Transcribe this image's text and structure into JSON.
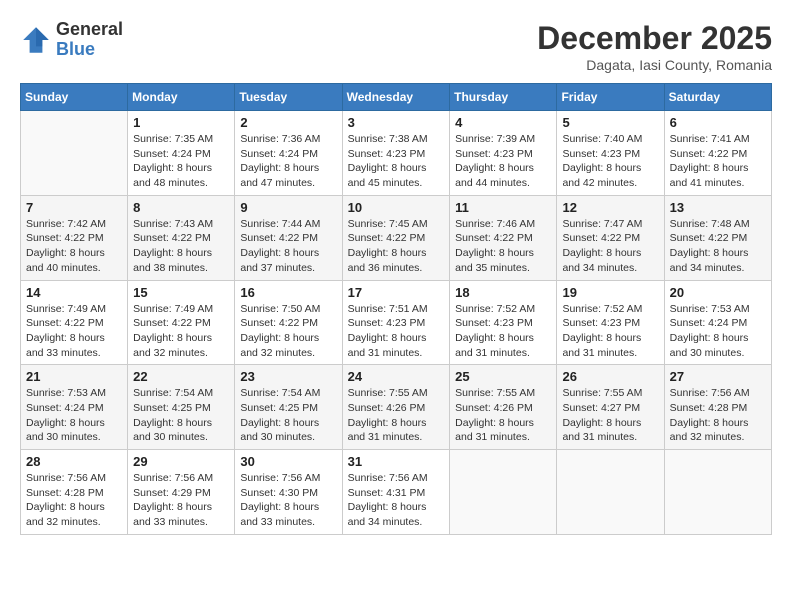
{
  "header": {
    "logo_line1": "General",
    "logo_line2": "Blue",
    "month": "December 2025",
    "location": "Dagata, Iasi County, Romania"
  },
  "weekdays": [
    "Sunday",
    "Monday",
    "Tuesday",
    "Wednesday",
    "Thursday",
    "Friday",
    "Saturday"
  ],
  "weeks": [
    [
      {
        "day": "",
        "sunrise": "",
        "sunset": "",
        "daylight": ""
      },
      {
        "day": "1",
        "sunrise": "Sunrise: 7:35 AM",
        "sunset": "Sunset: 4:24 PM",
        "daylight": "Daylight: 8 hours and 48 minutes."
      },
      {
        "day": "2",
        "sunrise": "Sunrise: 7:36 AM",
        "sunset": "Sunset: 4:24 PM",
        "daylight": "Daylight: 8 hours and 47 minutes."
      },
      {
        "day": "3",
        "sunrise": "Sunrise: 7:38 AM",
        "sunset": "Sunset: 4:23 PM",
        "daylight": "Daylight: 8 hours and 45 minutes."
      },
      {
        "day": "4",
        "sunrise": "Sunrise: 7:39 AM",
        "sunset": "Sunset: 4:23 PM",
        "daylight": "Daylight: 8 hours and 44 minutes."
      },
      {
        "day": "5",
        "sunrise": "Sunrise: 7:40 AM",
        "sunset": "Sunset: 4:23 PM",
        "daylight": "Daylight: 8 hours and 42 minutes."
      },
      {
        "day": "6",
        "sunrise": "Sunrise: 7:41 AM",
        "sunset": "Sunset: 4:22 PM",
        "daylight": "Daylight: 8 hours and 41 minutes."
      }
    ],
    [
      {
        "day": "7",
        "sunrise": "Sunrise: 7:42 AM",
        "sunset": "Sunset: 4:22 PM",
        "daylight": "Daylight: 8 hours and 40 minutes."
      },
      {
        "day": "8",
        "sunrise": "Sunrise: 7:43 AM",
        "sunset": "Sunset: 4:22 PM",
        "daylight": "Daylight: 8 hours and 38 minutes."
      },
      {
        "day": "9",
        "sunrise": "Sunrise: 7:44 AM",
        "sunset": "Sunset: 4:22 PM",
        "daylight": "Daylight: 8 hours and 37 minutes."
      },
      {
        "day": "10",
        "sunrise": "Sunrise: 7:45 AM",
        "sunset": "Sunset: 4:22 PM",
        "daylight": "Daylight: 8 hours and 36 minutes."
      },
      {
        "day": "11",
        "sunrise": "Sunrise: 7:46 AM",
        "sunset": "Sunset: 4:22 PM",
        "daylight": "Daylight: 8 hours and 35 minutes."
      },
      {
        "day": "12",
        "sunrise": "Sunrise: 7:47 AM",
        "sunset": "Sunset: 4:22 PM",
        "daylight": "Daylight: 8 hours and 34 minutes."
      },
      {
        "day": "13",
        "sunrise": "Sunrise: 7:48 AM",
        "sunset": "Sunset: 4:22 PM",
        "daylight": "Daylight: 8 hours and 34 minutes."
      }
    ],
    [
      {
        "day": "14",
        "sunrise": "Sunrise: 7:49 AM",
        "sunset": "Sunset: 4:22 PM",
        "daylight": "Daylight: 8 hours and 33 minutes."
      },
      {
        "day": "15",
        "sunrise": "Sunrise: 7:49 AM",
        "sunset": "Sunset: 4:22 PM",
        "daylight": "Daylight: 8 hours and 32 minutes."
      },
      {
        "day": "16",
        "sunrise": "Sunrise: 7:50 AM",
        "sunset": "Sunset: 4:22 PM",
        "daylight": "Daylight: 8 hours and 32 minutes."
      },
      {
        "day": "17",
        "sunrise": "Sunrise: 7:51 AM",
        "sunset": "Sunset: 4:23 PM",
        "daylight": "Daylight: 8 hours and 31 minutes."
      },
      {
        "day": "18",
        "sunrise": "Sunrise: 7:52 AM",
        "sunset": "Sunset: 4:23 PM",
        "daylight": "Daylight: 8 hours and 31 minutes."
      },
      {
        "day": "19",
        "sunrise": "Sunrise: 7:52 AM",
        "sunset": "Sunset: 4:23 PM",
        "daylight": "Daylight: 8 hours and 31 minutes."
      },
      {
        "day": "20",
        "sunrise": "Sunrise: 7:53 AM",
        "sunset": "Sunset: 4:24 PM",
        "daylight": "Daylight: 8 hours and 30 minutes."
      }
    ],
    [
      {
        "day": "21",
        "sunrise": "Sunrise: 7:53 AM",
        "sunset": "Sunset: 4:24 PM",
        "daylight": "Daylight: 8 hours and 30 minutes."
      },
      {
        "day": "22",
        "sunrise": "Sunrise: 7:54 AM",
        "sunset": "Sunset: 4:25 PM",
        "daylight": "Daylight: 8 hours and 30 minutes."
      },
      {
        "day": "23",
        "sunrise": "Sunrise: 7:54 AM",
        "sunset": "Sunset: 4:25 PM",
        "daylight": "Daylight: 8 hours and 30 minutes."
      },
      {
        "day": "24",
        "sunrise": "Sunrise: 7:55 AM",
        "sunset": "Sunset: 4:26 PM",
        "daylight": "Daylight: 8 hours and 31 minutes."
      },
      {
        "day": "25",
        "sunrise": "Sunrise: 7:55 AM",
        "sunset": "Sunset: 4:26 PM",
        "daylight": "Daylight: 8 hours and 31 minutes."
      },
      {
        "day": "26",
        "sunrise": "Sunrise: 7:55 AM",
        "sunset": "Sunset: 4:27 PM",
        "daylight": "Daylight: 8 hours and 31 minutes."
      },
      {
        "day": "27",
        "sunrise": "Sunrise: 7:56 AM",
        "sunset": "Sunset: 4:28 PM",
        "daylight": "Daylight: 8 hours and 32 minutes."
      }
    ],
    [
      {
        "day": "28",
        "sunrise": "Sunrise: 7:56 AM",
        "sunset": "Sunset: 4:28 PM",
        "daylight": "Daylight: 8 hours and 32 minutes."
      },
      {
        "day": "29",
        "sunrise": "Sunrise: 7:56 AM",
        "sunset": "Sunset: 4:29 PM",
        "daylight": "Daylight: 8 hours and 33 minutes."
      },
      {
        "day": "30",
        "sunrise": "Sunrise: 7:56 AM",
        "sunset": "Sunset: 4:30 PM",
        "daylight": "Daylight: 8 hours and 33 minutes."
      },
      {
        "day": "31",
        "sunrise": "Sunrise: 7:56 AM",
        "sunset": "Sunset: 4:31 PM",
        "daylight": "Daylight: 8 hours and 34 minutes."
      },
      {
        "day": "",
        "sunrise": "",
        "sunset": "",
        "daylight": ""
      },
      {
        "day": "",
        "sunrise": "",
        "sunset": "",
        "daylight": ""
      },
      {
        "day": "",
        "sunrise": "",
        "sunset": "",
        "daylight": ""
      }
    ]
  ]
}
